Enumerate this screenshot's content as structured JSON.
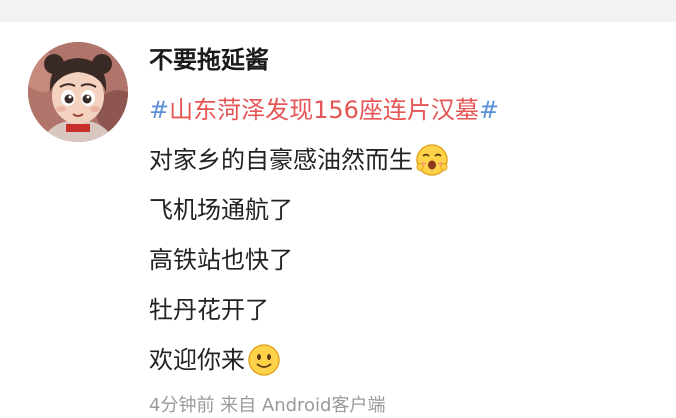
{
  "post": {
    "username": "不要拖延酱",
    "hashtag": {
      "hash_open": "#",
      "topic": "山东菏泽发现156座连片汉墓",
      "hash_close": "#"
    },
    "lines": [
      "对家乡的自豪感油然而生",
      "飞机场通航了",
      "高铁站也快了",
      "牡丹花开了",
      "欢迎你来"
    ],
    "footer": "4分钟前 来自 Android客户端"
  },
  "icons": {
    "line1_emoji": "blushing-happy-face-emoji",
    "line5_emoji": "smiling-face-emoji"
  }
}
